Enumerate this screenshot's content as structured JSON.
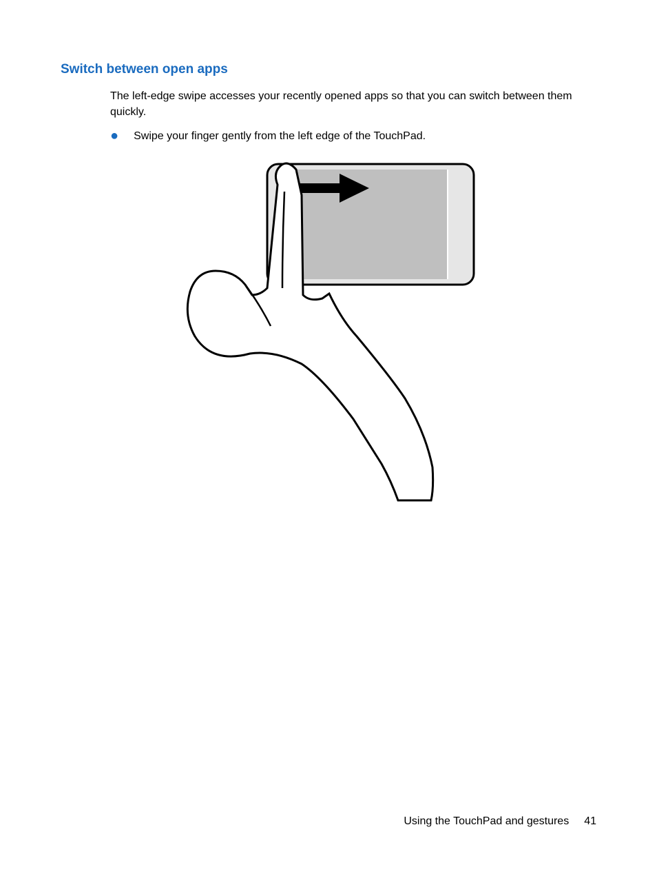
{
  "heading": "Switch between open apps",
  "paragraph": "The left-edge swipe accesses your recently opened apps so that you can switch between them quickly.",
  "bullet": "Swipe your finger gently from the left edge of the TouchPad.",
  "footer": {
    "section": "Using the TouchPad and gestures",
    "page": "41"
  },
  "illustration_alt": "Hand with index finger swiping from left edge of TouchPad to the right, arrow indicating swipe direction"
}
